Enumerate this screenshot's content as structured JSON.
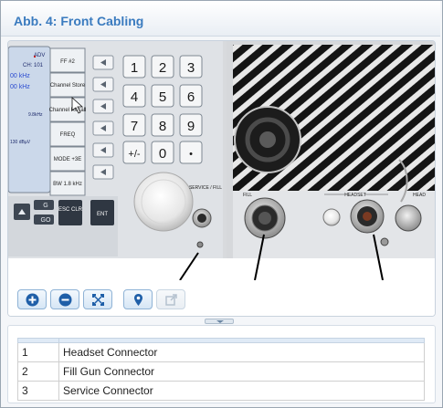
{
  "panel": {
    "title": "Abb. 4: Front Cabling"
  },
  "device": {
    "display_lines": [
      "ADV",
      "CH: 101",
      "00 kHz",
      "00 kHz",
      "9.8kHz",
      "130 dBµV"
    ],
    "softkeys": [
      "FF #2",
      "Channel Store",
      "Channel Recall",
      "FREQ",
      "MODE +3E",
      "BW 1.8 kHz"
    ],
    "keypad": [
      "1",
      "2",
      "3",
      "4",
      "5",
      "6",
      "7",
      "8",
      "9",
      "+/-",
      "0",
      "•"
    ],
    "small_keys": [
      "G",
      "GO"
    ],
    "esc_label": "ESC CLR",
    "ent_label": "ENT",
    "service_label": "SERVICE / FILL",
    "fill_label": "FILL",
    "headset_label": "HEADSET",
    "head_label": "HEAD"
  },
  "toolbar": {
    "zoom_in": "zoom-in-icon",
    "zoom_out": "zoom-out-icon",
    "fit": "fit-to-window-icon",
    "marker": "map-pin-icon",
    "external": "open-external-icon"
  },
  "legend": {
    "rows": [
      {
        "num": "1",
        "label": "Headset Connector"
      },
      {
        "num": "2",
        "label": "Fill Gun Connector"
      },
      {
        "num": "3",
        "label": "Service Connector"
      }
    ]
  }
}
